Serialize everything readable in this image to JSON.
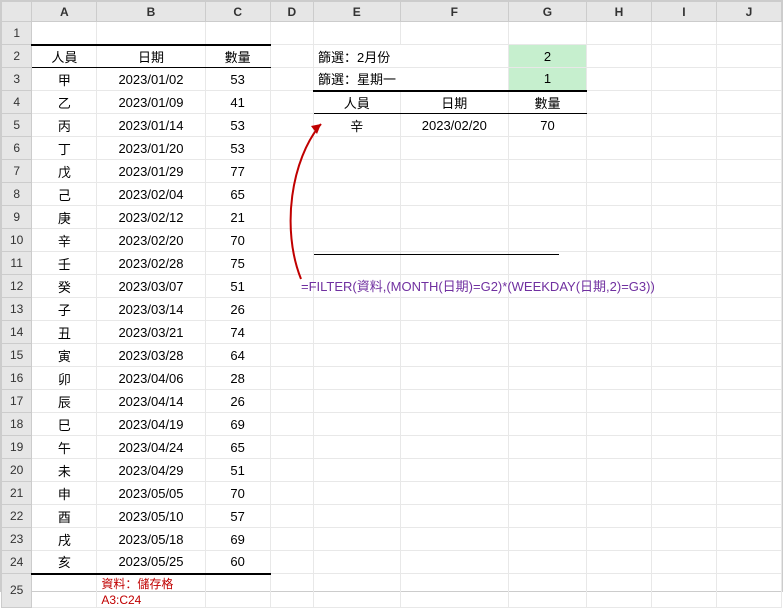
{
  "columns": [
    "",
    "A",
    "B",
    "C",
    "D",
    "E",
    "F",
    "G",
    "H",
    "I",
    "J"
  ],
  "rows": [
    "1",
    "2",
    "3",
    "4",
    "5",
    "6",
    "7",
    "8",
    "9",
    "10",
    "11",
    "12",
    "13",
    "14",
    "15",
    "16",
    "17",
    "18",
    "19",
    "20",
    "21",
    "22",
    "23",
    "24",
    "25"
  ],
  "left_headers": {
    "person": "人員",
    "date": "日期",
    "qty": "數量"
  },
  "filter1_label": "篩選：2月份",
  "filter1_value": "2",
  "filter2_label": "篩選：星期一",
  "filter2_value": "1",
  "right_headers": {
    "person": "人員",
    "date": "日期",
    "qty": "數量"
  },
  "result": {
    "person": "辛",
    "date": "2023/02/20",
    "qty": "70"
  },
  "formula": "=FILTER(資料,(MONTH(日期)=G2)*(WEEKDAY(日期,2)=G3))",
  "note": "資料：儲存格A3:C24",
  "table": [
    {
      "p": "甲",
      "d": "2023/01/02",
      "q": "53"
    },
    {
      "p": "乙",
      "d": "2023/01/09",
      "q": "41"
    },
    {
      "p": "丙",
      "d": "2023/01/14",
      "q": "53"
    },
    {
      "p": "丁",
      "d": "2023/01/20",
      "q": "53"
    },
    {
      "p": "戊",
      "d": "2023/01/29",
      "q": "77"
    },
    {
      "p": "己",
      "d": "2023/02/04",
      "q": "65"
    },
    {
      "p": "庚",
      "d": "2023/02/12",
      "q": "21"
    },
    {
      "p": "辛",
      "d": "2023/02/20",
      "q": "70"
    },
    {
      "p": "壬",
      "d": "2023/02/28",
      "q": "75"
    },
    {
      "p": "癸",
      "d": "2023/03/07",
      "q": "51"
    },
    {
      "p": "子",
      "d": "2023/03/14",
      "q": "26"
    },
    {
      "p": "丑",
      "d": "2023/03/21",
      "q": "74"
    },
    {
      "p": "寅",
      "d": "2023/03/28",
      "q": "64"
    },
    {
      "p": "卯",
      "d": "2023/04/06",
      "q": "28"
    },
    {
      "p": "辰",
      "d": "2023/04/14",
      "q": "26"
    },
    {
      "p": "巳",
      "d": "2023/04/19",
      "q": "69"
    },
    {
      "p": "午",
      "d": "2023/04/24",
      "q": "65"
    },
    {
      "p": "未",
      "d": "2023/04/29",
      "q": "51"
    },
    {
      "p": "申",
      "d": "2023/05/05",
      "q": "70"
    },
    {
      "p": "酉",
      "d": "2023/05/10",
      "q": "57"
    },
    {
      "p": "戌",
      "d": "2023/05/18",
      "q": "69"
    },
    {
      "p": "亥",
      "d": "2023/05/25",
      "q": "60"
    }
  ],
  "chart_data": {
    "type": "table",
    "title": "資料：儲存格A3:C24",
    "columns": [
      "人員",
      "日期",
      "數量"
    ],
    "rows": [
      [
        "甲",
        "2023/01/02",
        53
      ],
      [
        "乙",
        "2023/01/09",
        41
      ],
      [
        "丙",
        "2023/01/14",
        53
      ],
      [
        "丁",
        "2023/01/20",
        53
      ],
      [
        "戊",
        "2023/01/29",
        77
      ],
      [
        "己",
        "2023/02/04",
        65
      ],
      [
        "庚",
        "2023/02/12",
        21
      ],
      [
        "辛",
        "2023/02/20",
        70
      ],
      [
        "壬",
        "2023/02/28",
        75
      ],
      [
        "癸",
        "2023/03/07",
        51
      ],
      [
        "子",
        "2023/03/14",
        26
      ],
      [
        "丑",
        "2023/03/21",
        74
      ],
      [
        "寅",
        "2023/03/28",
        64
      ],
      [
        "卯",
        "2023/04/06",
        28
      ],
      [
        "辰",
        "2023/04/14",
        26
      ],
      [
        "巳",
        "2023/04/19",
        69
      ],
      [
        "午",
        "2023/04/24",
        65
      ],
      [
        "未",
        "2023/04/29",
        51
      ],
      [
        "申",
        "2023/05/05",
        70
      ],
      [
        "酉",
        "2023/05/10",
        57
      ],
      [
        "戌",
        "2023/05/18",
        69
      ],
      [
        "亥",
        "2023/05/25",
        60
      ]
    ]
  }
}
